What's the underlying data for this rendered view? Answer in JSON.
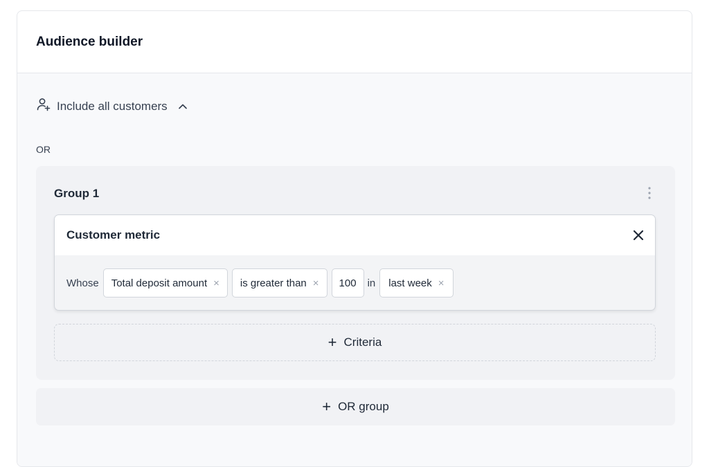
{
  "card": {
    "title": "Audience builder"
  },
  "include": {
    "label": "Include all customers",
    "icon": "user-plus-icon",
    "toggle_icon": "chevron-up-icon"
  },
  "operator": "OR",
  "group": {
    "title": "Group 1",
    "menu_icon": "more-vertical-icon",
    "criteria": {
      "title": "Customer metric",
      "close_icon": "close-icon",
      "whose_label": "Whose",
      "metric": "Total deposit amount",
      "comparator": "is greater than",
      "value": "100",
      "in_label": "in",
      "period": "last week",
      "remove_glyph": "×"
    },
    "add_criteria": {
      "plus": "+",
      "label": "Criteria"
    }
  },
  "add_or_group": {
    "plus": "+",
    "label": "OR group"
  },
  "colors": {
    "border": "#e5e7eb",
    "body_bg": "#f8f9fb",
    "group_bg": "#f1f2f5",
    "text": "#1f2937",
    "muted": "#9ca3af"
  }
}
